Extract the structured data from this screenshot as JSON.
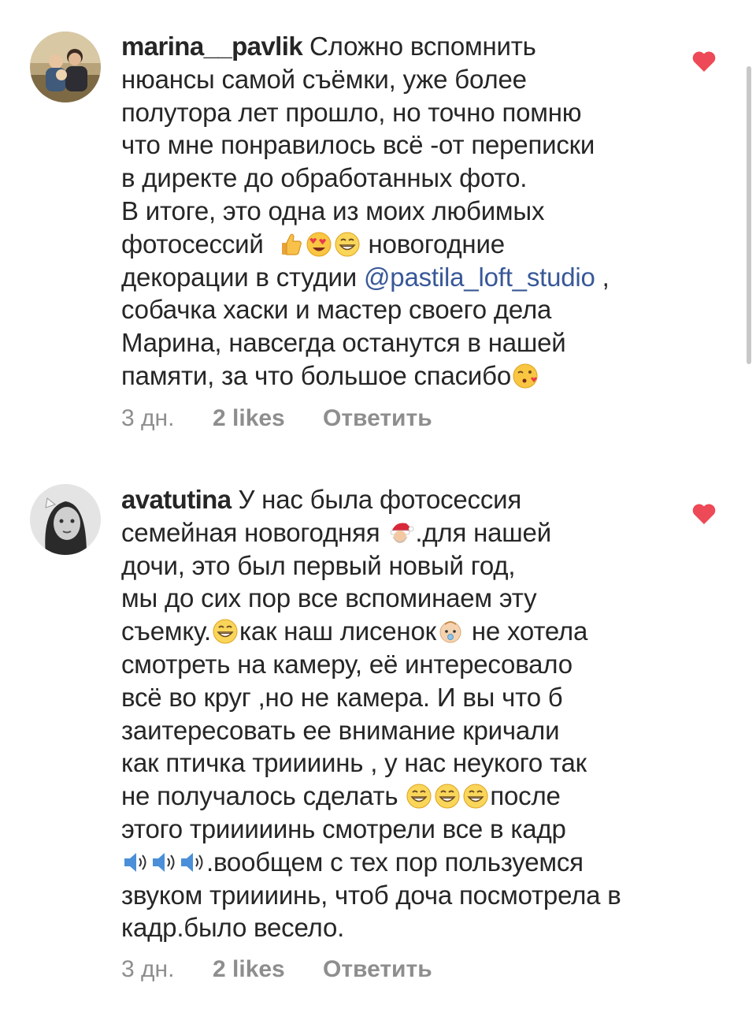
{
  "colors": {
    "text": "#262626",
    "meta": "#8e8e8e",
    "mention": "#385898",
    "heart": "#ed4956"
  },
  "comments": [
    {
      "username": "marina__pavlik",
      "avatar_icon": "family-photo-avatar",
      "lines": [
        " Сложно вспомнить",
        "нюансы самой съёмки, уже более",
        "полутора лет прошло, но точно помню",
        "что мне понравилось всё -от переписки",
        "в директе до обработанных фото.",
        "В итоге, это одна из моих любимых",
        "фотосессий",
        " новогодние",
        "декорации в студии ",
        "@pastila_loft_studio",
        " ,",
        "собачка хаски и мастер своего дела",
        "Марина, навсегда останутся в нашей",
        "памяти, за что большое спасибо"
      ],
      "emojis": [
        "thumbs-up-emoji",
        "heart-eyes-emoji",
        "grinning-emoji",
        "kissing-heart-emoji"
      ],
      "time": "3 дн.",
      "likes": "2 likes",
      "reply": "Ответить",
      "liked": true
    },
    {
      "username": "avatutina",
      "avatar_icon": "girl-photo-avatar",
      "lines": [
        " У нас была фотосессия",
        "семейная новогодняя ",
        ".для нашей",
        "дочи, это был первый новый год,",
        "мы до сих пор все вспоминаем эту",
        "съемку.",
        "как наш лисенок",
        " не хотела",
        "смотреть на камеру, её интересовало",
        "всё во круг ,но не камера. И вы что б",
        "заитересовать ее внимание кричали",
        "как птичка триииинь , у нас неукого так",
        "не получалось сделать ",
        "после",
        "этого трииииинь смотрели все  в кадр",
        ".вообщем с тех пор пользуемся",
        "звуком триииинь, чтоб доча посмотрела в",
        "кадр.было весело."
      ],
      "emojis": [
        "santa-emoji",
        "grinning-emoji",
        "baby-emoji",
        "grinning-emoji",
        "grinning-emoji",
        "grinning-emoji",
        "speaker-emoji",
        "speaker-emoji",
        "speaker-emoji"
      ],
      "time": "3 дн.",
      "likes": "2 likes",
      "reply": "Ответить",
      "liked": true
    }
  ]
}
